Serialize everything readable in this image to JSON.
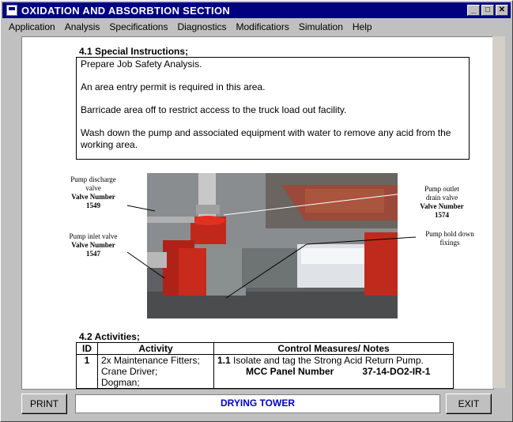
{
  "window": {
    "title": "OXIDATION AND ABSORBTION SECTION",
    "min": "_",
    "max": "□",
    "close": "✕"
  },
  "menu": [
    "Application",
    "Analysis",
    "Specifications",
    "Diagnostics",
    "Modificatiors",
    "Simulation",
    "Help"
  ],
  "section_41": {
    "heading": "4.1 Special Instructions;",
    "lines": [
      "Prepare Job Safety Analysis.",
      "An area entry permit is required in this area.",
      "Barricade area off to restrict access to the truck load out facility.",
      "Wash down the pump and associated equipment with water to remove any acid from the working area."
    ]
  },
  "photo_labels": {
    "discharge": {
      "desc1": "Pump discharge",
      "desc2": "valve",
      "vn": "Valve Number",
      "num": "1549"
    },
    "inlet": {
      "desc1": "Pump inlet valve",
      "vn": "Valve Number",
      "num": "1547"
    },
    "outlet": {
      "desc1": "Pump outlet",
      "desc2": "drain valve",
      "vn": "Valve Number",
      "num": "1574"
    },
    "holddown": {
      "desc1": "Pump hold down",
      "desc2": "fixings"
    }
  },
  "section_42": {
    "heading": "4.2 Activities;",
    "columns": [
      "ID",
      "Activity",
      "Control Measures/ Notes"
    ],
    "row1": {
      "id": "1",
      "activity": [
        "2x Maintenance Fitters;",
        "Crane Driver;",
        "Dogman;"
      ],
      "control_num": "1.1",
      "control_text": "Isolate and tag the Strong Acid Return Pump.",
      "mcc_label": "MCC Panel Number",
      "mcc_value": "37-14-DO2-IR-1"
    }
  },
  "bottom": {
    "print": "PRINT",
    "status": "DRYING TOWER",
    "exit": "EXIT"
  }
}
